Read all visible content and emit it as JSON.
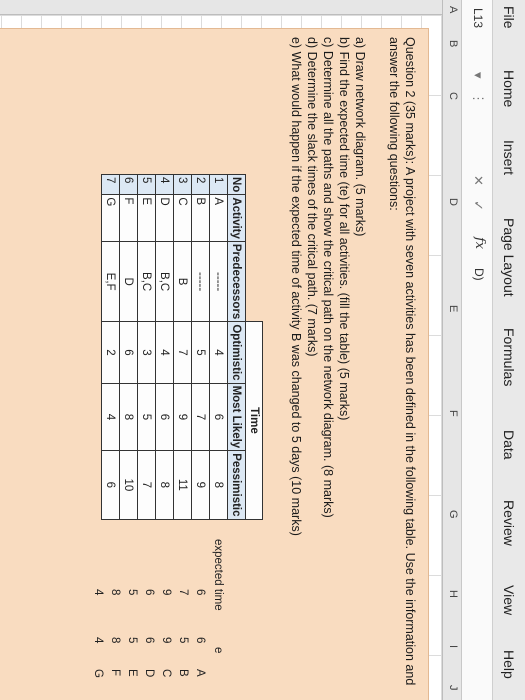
{
  "menu": [
    "File",
    "Home",
    "Insert",
    "Page Layout",
    "Formulas",
    "Data",
    "Review",
    "View",
    "Help"
  ],
  "formula_bar": {
    "name_box": "L13",
    "fx": "fx",
    "value": "D)"
  },
  "columns": [
    "A",
    "B",
    "C",
    "D",
    "E",
    "F",
    "G",
    "H",
    "I",
    "J"
  ],
  "question": {
    "intro": "Question 2 (35 marks): A project with seven activities has been defined in the following table. Use the information and answer the following questions:",
    "items": [
      "a) Draw network diagram. (5 marks)",
      "b) Find the expected time (te) for all activities. (fill the table) (5 marks)",
      "c) Determine all the paths and show the critical path on the network diagram. (8 marks)",
      "d) Determine the slack times of the critical path. (7 marks)",
      "e) What would happen if the expected time of activity B was changed to 5 days (10 marks)"
    ]
  },
  "table": {
    "time_header": "Time",
    "headers": [
      "No",
      "Activity",
      "Predecessors",
      "Optimistic",
      "Most Likely",
      "Pessimistic"
    ],
    "rows": [
      [
        "1",
        "A",
        "-----",
        "4",
        "6",
        "8"
      ],
      [
        "2",
        "B",
        "-----",
        "5",
        "7",
        "9"
      ],
      [
        "3",
        "C",
        "B",
        "7",
        "9",
        "11"
      ],
      [
        "4",
        "D",
        "B,C",
        "4",
        "6",
        "8"
      ],
      [
        "5",
        "E",
        "B,C",
        "3",
        "5",
        "7"
      ],
      [
        "6",
        "F",
        "D",
        "6",
        "8",
        "10"
      ],
      [
        "7",
        "G",
        "E,F",
        "2",
        "4",
        "6"
      ]
    ]
  },
  "side": {
    "header_expected": "expected time",
    "header_e": "e",
    "expected": [
      "6",
      "7",
      "9",
      "6",
      "5",
      "8",
      "4"
    ],
    "e": [
      "6",
      "5",
      "9",
      "6",
      "5",
      "8",
      "4"
    ],
    "letters": [
      "A",
      "B",
      "C",
      "D",
      "E",
      "F",
      "G"
    ]
  }
}
